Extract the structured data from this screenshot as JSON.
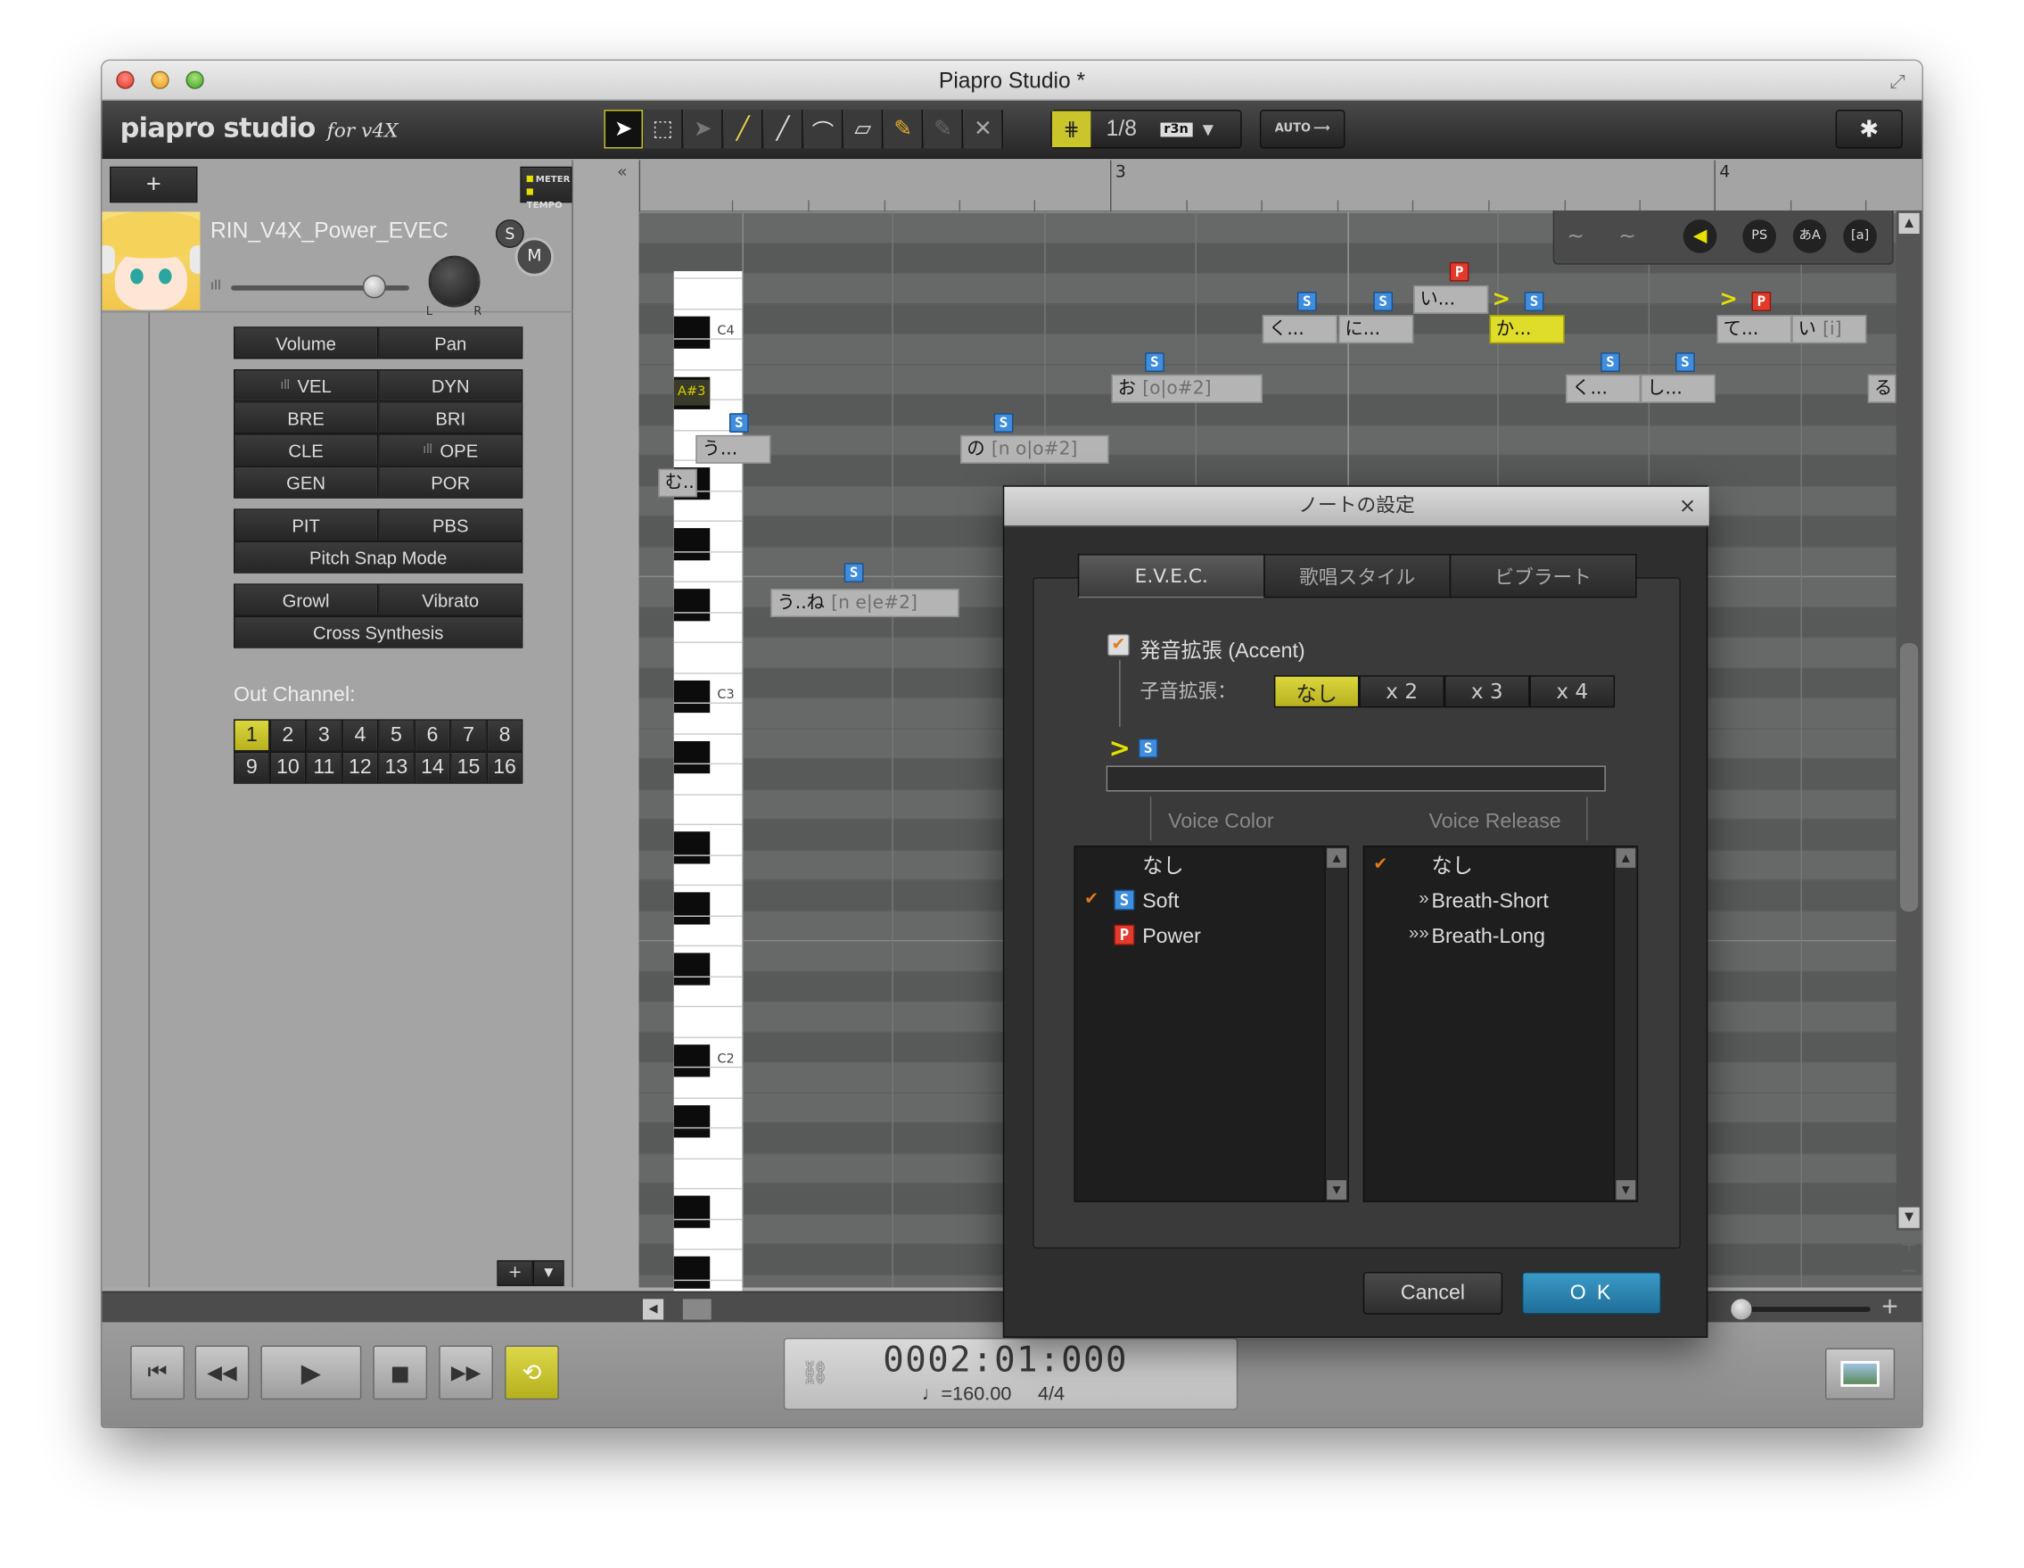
{
  "window": {
    "title": "Piapro Studio *"
  },
  "toolbar": {
    "logo_main": "piapro studio",
    "logo_sub": "for v4X",
    "quantize": "1/8",
    "quant_mode": "r3n",
    "auto_label": "AUTO",
    "settings_icon": "gear-icon"
  },
  "track": {
    "add_label": "+",
    "meter_label": "METER",
    "tempo_label": "TEMPO",
    "name": "RIN_V4X_Power_EVEC",
    "solo_label": "S",
    "mute_label": "M",
    "pan_l": "L",
    "pan_r": "R"
  },
  "params": {
    "volume": "Volume",
    "pan": "Pan",
    "vel": "VEL",
    "dyn": "DYN",
    "bre": "BRE",
    "bri": "BRI",
    "cle": "CLE",
    "ope": "OPE",
    "gen": "GEN",
    "por": "POR",
    "pit": "PIT",
    "pbs": "PBS",
    "pitch_snap": "Pitch Snap Mode",
    "growl": "Growl",
    "vibrato": "Vibrato",
    "cross": "Cross Synthesis"
  },
  "out_channel": {
    "label": "Out Channel:",
    "row1": [
      "1",
      "2",
      "3",
      "4",
      "5",
      "6",
      "7",
      "8"
    ],
    "row2": [
      "9",
      "10",
      "11",
      "12",
      "13",
      "14",
      "15",
      "16"
    ],
    "selected": "1"
  },
  "ruler": {
    "bar3": "3",
    "bar4": "4"
  },
  "keyboard": {
    "c4": "C4",
    "as3": "A#3",
    "c3": "C3",
    "c2": "C2"
  },
  "notes": [
    {
      "lyric": "む..",
      "phon": ""
    },
    {
      "lyric": "う...",
      "phon": ""
    },
    {
      "lyric": "う..ね",
      "phon": "[n e|e#2]"
    },
    {
      "lyric": "の",
      "phon": "[n o|o#2]"
    },
    {
      "lyric": "お",
      "phon": "[o|o#2]"
    },
    {
      "lyric": "く...",
      "phon": ""
    },
    {
      "lyric": "に...",
      "phon": ""
    },
    {
      "lyric": "い...",
      "phon": ""
    },
    {
      "lyric": "か...",
      "phon": ""
    },
    {
      "lyric": "く...",
      "phon": ""
    },
    {
      "lyric": "し...",
      "phon": ""
    },
    {
      "lyric": "て...",
      "phon": ""
    },
    {
      "lyric": "い",
      "phon": "[i]"
    },
    {
      "lyric": "る",
      "phon": ""
    }
  ],
  "badges": {
    "soft": "S",
    "power": "P",
    "accent": ">"
  },
  "transport": {
    "time": "0002:01:000",
    "tempo": "♩=160.00",
    "signature": "4/4"
  },
  "dialog": {
    "title": "ノートの設定",
    "close": "×",
    "tabs": [
      "E.V.E.C.",
      "歌唱スタイル",
      "ビブラート"
    ],
    "accent_label": "発音拡張 (Accent)",
    "consonant_label": "子音拡張：",
    "consonant_options": [
      "なし",
      "x 2",
      "x 3",
      "x 4"
    ],
    "consonant_selected": "なし",
    "voice_color_label": "Voice Color",
    "voice_release_label": "Voice Release",
    "voice_color": [
      {
        "icon": "",
        "label": "なし",
        "checked": false
      },
      {
        "icon": "S",
        "label": "Soft",
        "checked": true
      },
      {
        "icon": "P",
        "label": "Power",
        "checked": false
      }
    ],
    "voice_release": [
      {
        "icon": "",
        "label": "なし",
        "checked": true
      },
      {
        "icon": "»",
        "label": "Breath-Short",
        "checked": false
      },
      {
        "icon": "»»",
        "label": "Breath-Long",
        "checked": false
      }
    ],
    "cancel": "Cancel",
    "ok": "O K"
  },
  "colors": {
    "accent_yellow": "#c9c52a",
    "ok_blue": "#2a83b3",
    "soft_blue": "#3f8ddc",
    "power_red": "#e23a2c"
  }
}
